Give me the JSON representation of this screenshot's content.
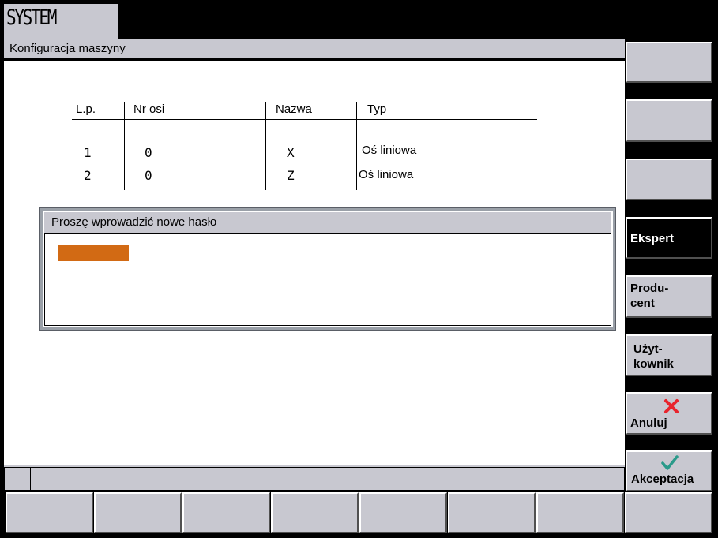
{
  "header": {
    "system_label": "SYSTEM",
    "screen_title": "Konfiguracja maszyny"
  },
  "table": {
    "columns": [
      "L.p.",
      "Nr osi",
      "Nazwa",
      "Typ"
    ],
    "rows": [
      {
        "lp": "1",
        "nr_osi": "0",
        "nazwa": "X",
        "typ": "Oś liniowa"
      },
      {
        "lp": "2",
        "nr_osi": "0",
        "nazwa": "Z",
        "typ": "Oś liniowa"
      }
    ]
  },
  "dialog": {
    "title": "Proszę wprowadzić nowe hasło",
    "password_value": ""
  },
  "softkeys": {
    "ekspert": "Ekspert",
    "producent_1": "Produ-",
    "producent_2": "cent",
    "uzytkownik_1": "Użyt-",
    "uzytkownik_2": "kownik",
    "anuluj": "Anuluj",
    "akceptacja": "Akceptacja"
  },
  "icons": {
    "cancel": "red-x-icon",
    "accept": "green-check-icon"
  },
  "colors": {
    "panel_gray": "#c8c8d0",
    "input_orange": "#d26a14",
    "cancel_red": "#e8242c",
    "accept_green": "#2a9a8a",
    "active_key": "#000000"
  }
}
